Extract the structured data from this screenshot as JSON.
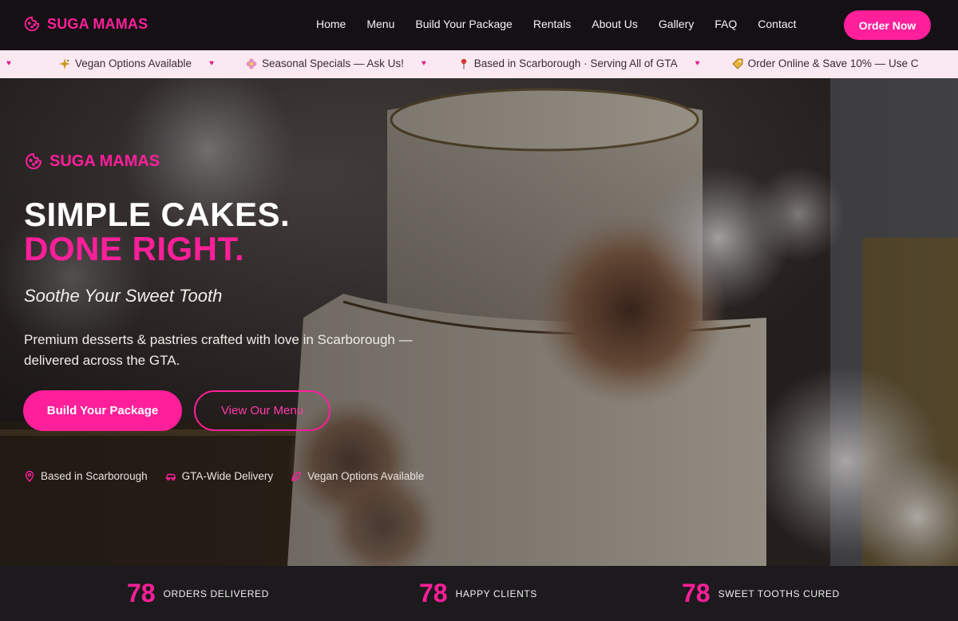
{
  "brand": {
    "name": "SUGA MAMAS",
    "accent": "#ff1f9a"
  },
  "nav": {
    "links": [
      "Home",
      "Menu",
      "Build Your Package",
      "Rentals",
      "About Us",
      "Gallery",
      "FAQ",
      "Contact"
    ],
    "cta": "Order Now"
  },
  "ticker": {
    "items": [
      {
        "icon": "sparkle-icon",
        "text": "Vegan Options Available"
      },
      {
        "icon": "flower-icon",
        "text": "Seasonal Specials — Ask Us!"
      },
      {
        "icon": "pin-icon",
        "text": "Based in Scarborough · Serving All of GTA"
      },
      {
        "icon": "tag-icon",
        "text": "Order Online & Save 10% — Use C"
      }
    ]
  },
  "hero": {
    "brand": "SUGA MAMAS",
    "headline_1": "SIMPLE CAKES.",
    "headline_2": "DONE RIGHT.",
    "tagline": "Soothe Your Sweet Tooth",
    "description": "Premium desserts & pastries crafted with love in Scarborough — delivered across the GTA.",
    "primary_button": "Build Your Package",
    "secondary_button": "View Our Menu",
    "features": [
      {
        "icon": "location-pin-icon",
        "text": "Based in Scarborough"
      },
      {
        "icon": "car-icon",
        "text": "GTA-Wide Delivery"
      },
      {
        "icon": "leaf-icon",
        "text": "Vegan Options Available"
      }
    ]
  },
  "stats": [
    {
      "number": "78",
      "label": "ORDERS DELIVERED"
    },
    {
      "number": "78",
      "label": "HAPPY CLIENTS"
    },
    {
      "number": "78",
      "label": "SWEET TOOTHS CURED"
    }
  ]
}
